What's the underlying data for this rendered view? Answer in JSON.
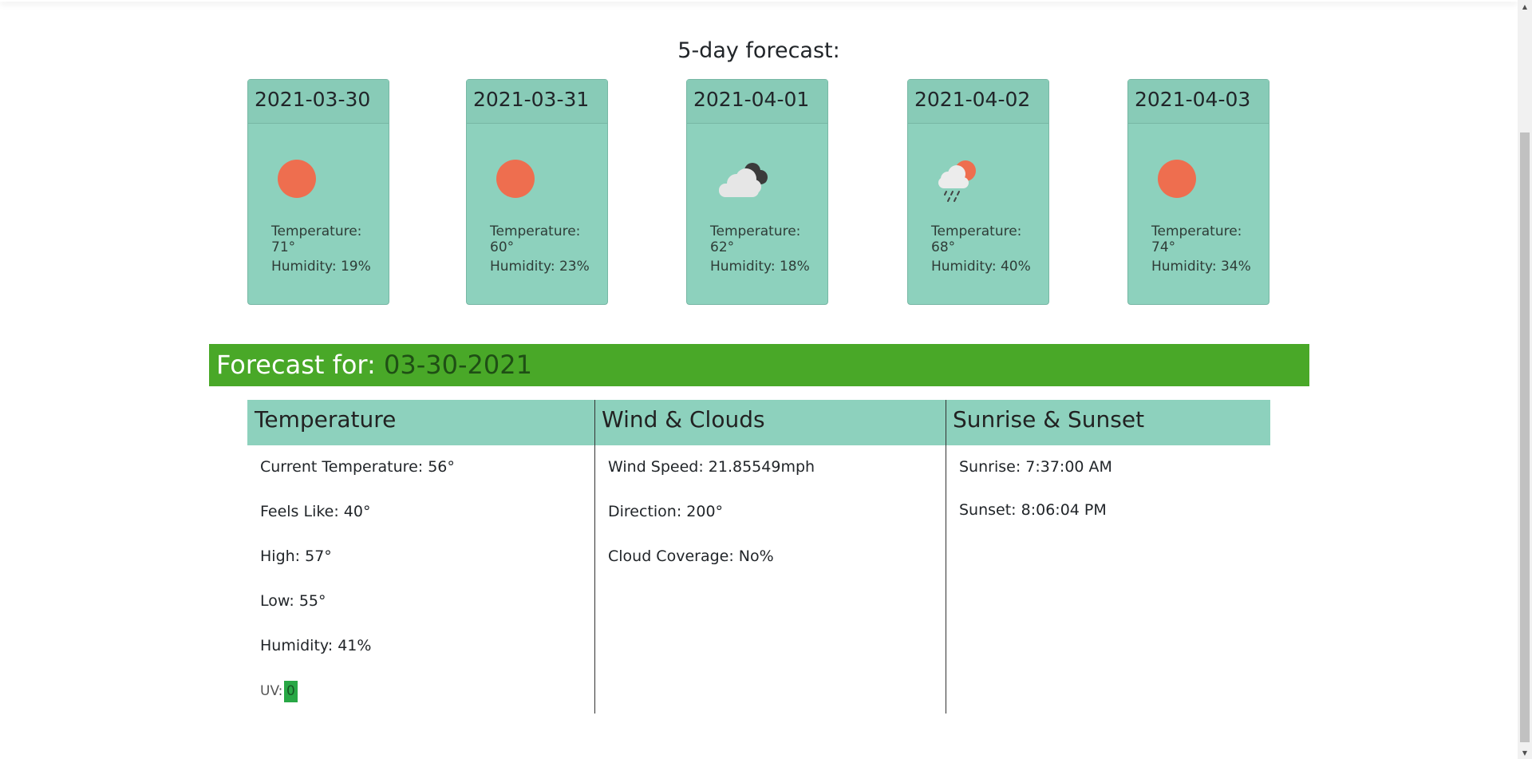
{
  "forecast_title": "5-day forecast:",
  "days": [
    {
      "date": "2021-03-30",
      "icon": "sun-icon",
      "temperature": "Temperature: 71°",
      "humidity": "Humidity: 19%"
    },
    {
      "date": "2021-03-31",
      "icon": "sun-icon",
      "temperature": "Temperature: 60°",
      "humidity": "Humidity: 23%"
    },
    {
      "date": "2021-04-01",
      "icon": "cloudy-icon",
      "temperature": "Temperature: 62°",
      "humidity": "Humidity: 18%"
    },
    {
      "date": "2021-04-02",
      "icon": "rain-sun-icon",
      "temperature": "Temperature: 68°",
      "humidity": "Humidity: 40%"
    },
    {
      "date": "2021-04-03",
      "icon": "sun-icon",
      "temperature": "Temperature: 74°",
      "humidity": "Humidity: 34%"
    }
  ],
  "forecast_for": {
    "label": "Forecast for:",
    "date": "03-30-2021"
  },
  "temperature_section": {
    "title": "Temperature",
    "current": "Current Temperature: 56°",
    "feels_like": "Feels Like: 40°",
    "high": "High: 57°",
    "low": "Low: 55°",
    "humidity": "Humidity: 41%",
    "uv_label": "UV:",
    "uv_value": "0"
  },
  "wind_section": {
    "title": "Wind & Clouds",
    "speed": "Wind Speed: 21.85549mph",
    "direction": "Direction: 200°",
    "clouds": "Cloud Coverage: No%"
  },
  "sun_section": {
    "title": "Sunrise & Sunset",
    "sunrise": "Sunrise: 7:37:00 AM",
    "sunset": "Sunset: 8:06:04 PM"
  },
  "colors": {
    "card_bg": "#8dd1bd",
    "bar_green": "#49a828",
    "sun_orange": "#ee6e4f",
    "uv_green": "#28a745"
  }
}
